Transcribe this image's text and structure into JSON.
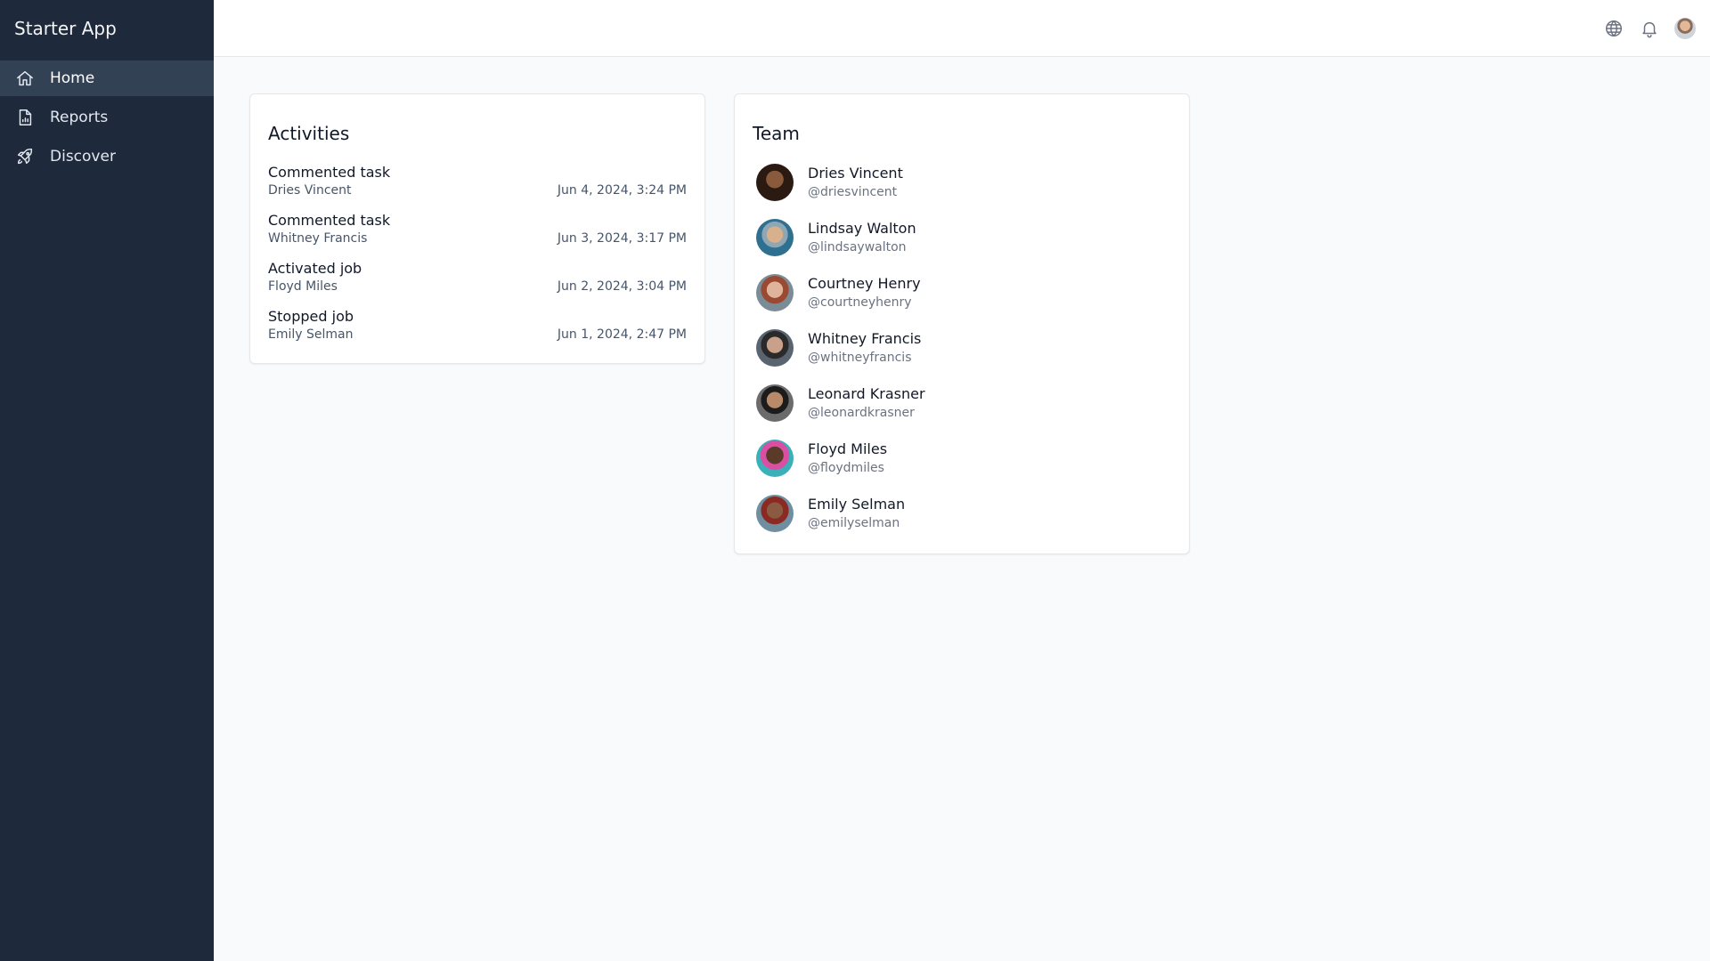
{
  "app": {
    "title": "Starter App"
  },
  "sidebar": {
    "items": [
      {
        "label": "Home",
        "icon": "home-icon",
        "active": true
      },
      {
        "label": "Reports",
        "icon": "document-chart-icon",
        "active": false
      },
      {
        "label": "Discover",
        "icon": "rocket-icon",
        "active": false
      }
    ]
  },
  "topbar": {
    "icons": [
      "globe-icon",
      "bell-icon",
      "user-avatar"
    ]
  },
  "activities": {
    "title": "Activities",
    "items": [
      {
        "title": "Commented task",
        "user": "Dries Vincent",
        "time": "Jun 4, 2024, 3:24 PM"
      },
      {
        "title": "Commented task",
        "user": "Whitney Francis",
        "time": "Jun 3, 2024, 3:17 PM"
      },
      {
        "title": "Activated job",
        "user": "Floyd Miles",
        "time": "Jun 2, 2024, 3:04 PM"
      },
      {
        "title": "Stopped job",
        "user": "Emily Selman",
        "time": "Jun 1, 2024, 2:47 PM"
      }
    ]
  },
  "team": {
    "title": "Team",
    "members": [
      {
        "name": "Dries Vincent",
        "handle": "@driesvincent"
      },
      {
        "name": "Lindsay Walton",
        "handle": "@lindsaywalton"
      },
      {
        "name": "Courtney Henry",
        "handle": "@courtneyhenry"
      },
      {
        "name": "Whitney Francis",
        "handle": "@whitneyfrancis"
      },
      {
        "name": "Leonard Krasner",
        "handle": "@leonardkrasner"
      },
      {
        "name": "Floyd Miles",
        "handle": "@floydmiles"
      },
      {
        "name": "Emily Selman",
        "handle": "@emilyselman"
      }
    ]
  },
  "colors": {
    "sidebar_bg": "#1e293b",
    "sidebar_active": "#334155",
    "page_bg": "#f8fafc"
  }
}
